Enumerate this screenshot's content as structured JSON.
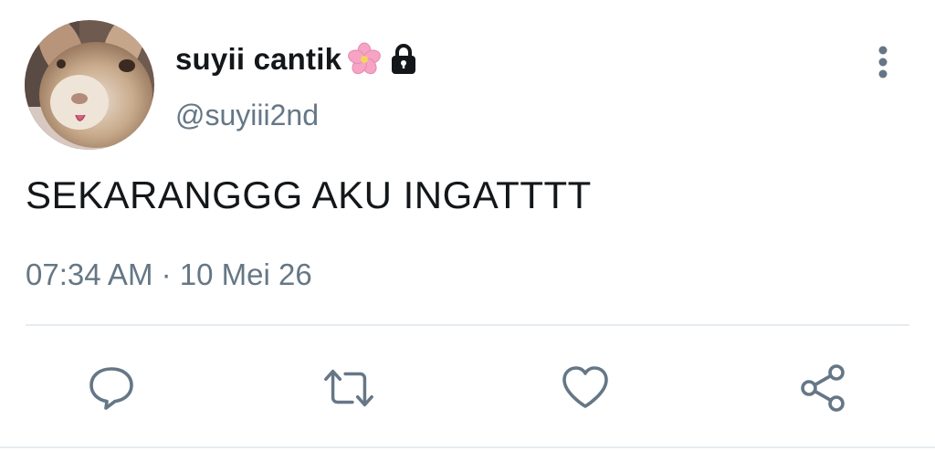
{
  "user": {
    "display_name": "suyii cantik",
    "handle": "@suyiii2nd",
    "avatar_icon": "bunny-photo-avatar",
    "protected": true,
    "badge_icon": "cherry-blossom-emoji"
  },
  "tweet": {
    "text": "SEKARANGGG AKU INGATTTT",
    "timestamp": "07:34 AM · 10 Mei 26"
  },
  "actions": {
    "reply_icon": "reply-bubble-icon",
    "retweet_icon": "retweet-arrows-icon",
    "like_icon": "heart-icon",
    "share_icon": "share-nodes-icon",
    "more_icon": "vertical-dots-icon"
  },
  "colors": {
    "text_primary": "#14171a",
    "text_secondary": "#657786",
    "icon": "#657786",
    "divider": "#e6ecf0",
    "flower": "#f7a8c8"
  }
}
